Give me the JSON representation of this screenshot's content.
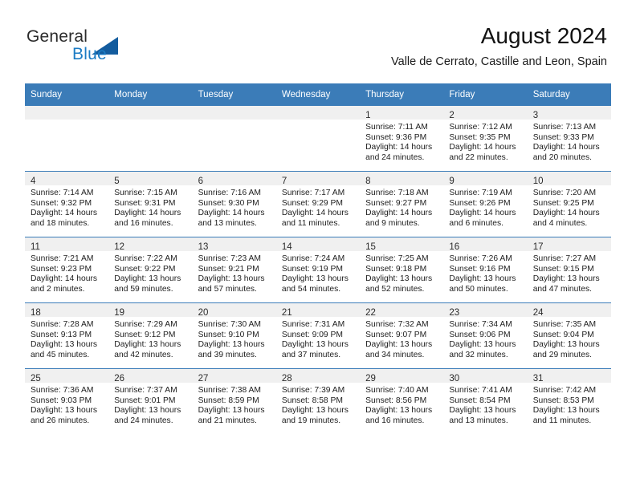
{
  "brand": {
    "name_part1": "General",
    "name_part2": "Blue",
    "triangle_color": "#135c9e",
    "blue_color": "#1c7cc4"
  },
  "header": {
    "title": "August 2024",
    "location": "Valle de Cerrato, Castille and Leon, Spain"
  },
  "theme": {
    "header_bar": "#3b7cb8",
    "daynum_band": "#f0f0f0",
    "row_divider": "#3b7cb8"
  },
  "weekdays": [
    "Sunday",
    "Monday",
    "Tuesday",
    "Wednesday",
    "Thursday",
    "Friday",
    "Saturday"
  ],
  "weeks": [
    [
      {
        "day": "",
        "sunrise": "",
        "sunset": "",
        "daylight1": "",
        "daylight2": ""
      },
      {
        "day": "",
        "sunrise": "",
        "sunset": "",
        "daylight1": "",
        "daylight2": ""
      },
      {
        "day": "",
        "sunrise": "",
        "sunset": "",
        "daylight1": "",
        "daylight2": ""
      },
      {
        "day": "",
        "sunrise": "",
        "sunset": "",
        "daylight1": "",
        "daylight2": ""
      },
      {
        "day": "1",
        "sunrise": "Sunrise: 7:11 AM",
        "sunset": "Sunset: 9:36 PM",
        "daylight1": "Daylight: 14 hours",
        "daylight2": "and 24 minutes."
      },
      {
        "day": "2",
        "sunrise": "Sunrise: 7:12 AM",
        "sunset": "Sunset: 9:35 PM",
        "daylight1": "Daylight: 14 hours",
        "daylight2": "and 22 minutes."
      },
      {
        "day": "3",
        "sunrise": "Sunrise: 7:13 AM",
        "sunset": "Sunset: 9:33 PM",
        "daylight1": "Daylight: 14 hours",
        "daylight2": "and 20 minutes."
      }
    ],
    [
      {
        "day": "4",
        "sunrise": "Sunrise: 7:14 AM",
        "sunset": "Sunset: 9:32 PM",
        "daylight1": "Daylight: 14 hours",
        "daylight2": "and 18 minutes."
      },
      {
        "day": "5",
        "sunrise": "Sunrise: 7:15 AM",
        "sunset": "Sunset: 9:31 PM",
        "daylight1": "Daylight: 14 hours",
        "daylight2": "and 16 minutes."
      },
      {
        "day": "6",
        "sunrise": "Sunrise: 7:16 AM",
        "sunset": "Sunset: 9:30 PM",
        "daylight1": "Daylight: 14 hours",
        "daylight2": "and 13 minutes."
      },
      {
        "day": "7",
        "sunrise": "Sunrise: 7:17 AM",
        "sunset": "Sunset: 9:29 PM",
        "daylight1": "Daylight: 14 hours",
        "daylight2": "and 11 minutes."
      },
      {
        "day": "8",
        "sunrise": "Sunrise: 7:18 AM",
        "sunset": "Sunset: 9:27 PM",
        "daylight1": "Daylight: 14 hours",
        "daylight2": "and 9 minutes."
      },
      {
        "day": "9",
        "sunrise": "Sunrise: 7:19 AM",
        "sunset": "Sunset: 9:26 PM",
        "daylight1": "Daylight: 14 hours",
        "daylight2": "and 6 minutes."
      },
      {
        "day": "10",
        "sunrise": "Sunrise: 7:20 AM",
        "sunset": "Sunset: 9:25 PM",
        "daylight1": "Daylight: 14 hours",
        "daylight2": "and 4 minutes."
      }
    ],
    [
      {
        "day": "11",
        "sunrise": "Sunrise: 7:21 AM",
        "sunset": "Sunset: 9:23 PM",
        "daylight1": "Daylight: 14 hours",
        "daylight2": "and 2 minutes."
      },
      {
        "day": "12",
        "sunrise": "Sunrise: 7:22 AM",
        "sunset": "Sunset: 9:22 PM",
        "daylight1": "Daylight: 13 hours",
        "daylight2": "and 59 minutes."
      },
      {
        "day": "13",
        "sunrise": "Sunrise: 7:23 AM",
        "sunset": "Sunset: 9:21 PM",
        "daylight1": "Daylight: 13 hours",
        "daylight2": "and 57 minutes."
      },
      {
        "day": "14",
        "sunrise": "Sunrise: 7:24 AM",
        "sunset": "Sunset: 9:19 PM",
        "daylight1": "Daylight: 13 hours",
        "daylight2": "and 54 minutes."
      },
      {
        "day": "15",
        "sunrise": "Sunrise: 7:25 AM",
        "sunset": "Sunset: 9:18 PM",
        "daylight1": "Daylight: 13 hours",
        "daylight2": "and 52 minutes."
      },
      {
        "day": "16",
        "sunrise": "Sunrise: 7:26 AM",
        "sunset": "Sunset: 9:16 PM",
        "daylight1": "Daylight: 13 hours",
        "daylight2": "and 50 minutes."
      },
      {
        "day": "17",
        "sunrise": "Sunrise: 7:27 AM",
        "sunset": "Sunset: 9:15 PM",
        "daylight1": "Daylight: 13 hours",
        "daylight2": "and 47 minutes."
      }
    ],
    [
      {
        "day": "18",
        "sunrise": "Sunrise: 7:28 AM",
        "sunset": "Sunset: 9:13 PM",
        "daylight1": "Daylight: 13 hours",
        "daylight2": "and 45 minutes."
      },
      {
        "day": "19",
        "sunrise": "Sunrise: 7:29 AM",
        "sunset": "Sunset: 9:12 PM",
        "daylight1": "Daylight: 13 hours",
        "daylight2": "and 42 minutes."
      },
      {
        "day": "20",
        "sunrise": "Sunrise: 7:30 AM",
        "sunset": "Sunset: 9:10 PM",
        "daylight1": "Daylight: 13 hours",
        "daylight2": "and 39 minutes."
      },
      {
        "day": "21",
        "sunrise": "Sunrise: 7:31 AM",
        "sunset": "Sunset: 9:09 PM",
        "daylight1": "Daylight: 13 hours",
        "daylight2": "and 37 minutes."
      },
      {
        "day": "22",
        "sunrise": "Sunrise: 7:32 AM",
        "sunset": "Sunset: 9:07 PM",
        "daylight1": "Daylight: 13 hours",
        "daylight2": "and 34 minutes."
      },
      {
        "day": "23",
        "sunrise": "Sunrise: 7:34 AM",
        "sunset": "Sunset: 9:06 PM",
        "daylight1": "Daylight: 13 hours",
        "daylight2": "and 32 minutes."
      },
      {
        "day": "24",
        "sunrise": "Sunrise: 7:35 AM",
        "sunset": "Sunset: 9:04 PM",
        "daylight1": "Daylight: 13 hours",
        "daylight2": "and 29 minutes."
      }
    ],
    [
      {
        "day": "25",
        "sunrise": "Sunrise: 7:36 AM",
        "sunset": "Sunset: 9:03 PM",
        "daylight1": "Daylight: 13 hours",
        "daylight2": "and 26 minutes."
      },
      {
        "day": "26",
        "sunrise": "Sunrise: 7:37 AM",
        "sunset": "Sunset: 9:01 PM",
        "daylight1": "Daylight: 13 hours",
        "daylight2": "and 24 minutes."
      },
      {
        "day": "27",
        "sunrise": "Sunrise: 7:38 AM",
        "sunset": "Sunset: 8:59 PM",
        "daylight1": "Daylight: 13 hours",
        "daylight2": "and 21 minutes."
      },
      {
        "day": "28",
        "sunrise": "Sunrise: 7:39 AM",
        "sunset": "Sunset: 8:58 PM",
        "daylight1": "Daylight: 13 hours",
        "daylight2": "and 19 minutes."
      },
      {
        "day": "29",
        "sunrise": "Sunrise: 7:40 AM",
        "sunset": "Sunset: 8:56 PM",
        "daylight1": "Daylight: 13 hours",
        "daylight2": "and 16 minutes."
      },
      {
        "day": "30",
        "sunrise": "Sunrise: 7:41 AM",
        "sunset": "Sunset: 8:54 PM",
        "daylight1": "Daylight: 13 hours",
        "daylight2": "and 13 minutes."
      },
      {
        "day": "31",
        "sunrise": "Sunrise: 7:42 AM",
        "sunset": "Sunset: 8:53 PM",
        "daylight1": "Daylight: 13 hours",
        "daylight2": "and 11 minutes."
      }
    ]
  ]
}
